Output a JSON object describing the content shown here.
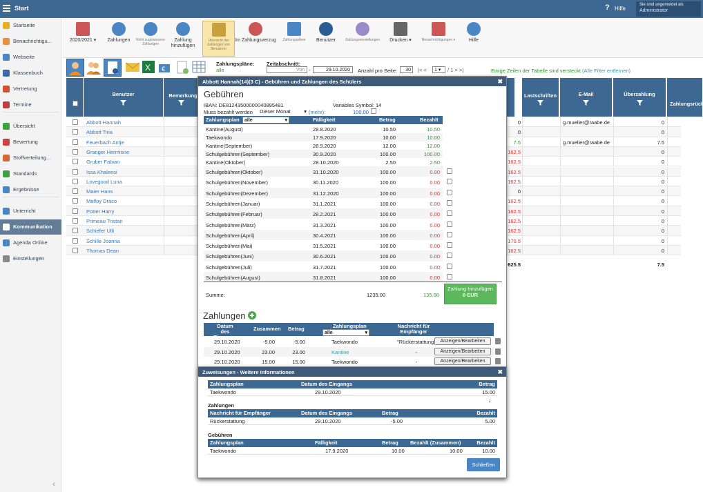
{
  "topbar": {
    "title": "Start",
    "help": "Hilfe",
    "user_line1": "Sie sind angemeldet als",
    "user_line2": "Administrator"
  },
  "sidebar": {
    "items": [
      {
        "label": "Startseite",
        "color": "#e8b020"
      },
      {
        "label": "Benachrichtigu...",
        "color": "#e89040"
      },
      {
        "label": "Webseite",
        "color": "#4a86c4"
      },
      {
        "label": "Klassenbuch",
        "color": "#3a6aa8"
      },
      {
        "label": "Vertretung",
        "color": "#d05030"
      },
      {
        "label": "Termine",
        "color": "#c04040"
      },
      {
        "label": "Übersicht",
        "color": "#40a040"
      },
      {
        "label": "Bewertung",
        "color": "#d04040"
      },
      {
        "label": "Stoffverteilung...",
        "color": "#d06a30"
      },
      {
        "label": "Standards",
        "color": "#40a040"
      },
      {
        "label": "Ergebnisse",
        "color": "#4a86c4"
      },
      {
        "label": "Unterricht",
        "color": "#4a86c4"
      },
      {
        "label": "Kommunikation",
        "color": "#fff"
      },
      {
        "label": "Agenda Online",
        "color": "#4a86c4"
      },
      {
        "label": "Einstellungen",
        "color": "#888"
      }
    ]
  },
  "toolbar": {
    "items": [
      {
        "label": "2020/2021 ▾",
        "icon": "calendar-icon"
      },
      {
        "label": "Zahlungen",
        "icon": "money-bag-icon"
      },
      {
        "label": "Nicht zugewiesene Zahlungen",
        "icon": "money-bag-icon"
      },
      {
        "label": "Zahlung hinzufügen",
        "icon": "money-add-icon"
      },
      {
        "label": "Übersicht der Zahlungen von Benutzern",
        "icon": "overview-icon"
      },
      {
        "label": "Im Zahlungsverzug",
        "icon": "money-overdue-icon"
      },
      {
        "label": "Zahlungspläne",
        "icon": "plan-icon"
      },
      {
        "label": "Benutzer",
        "icon": "user-icon"
      },
      {
        "label": "Zahlungseinstellungen",
        "icon": "gear-icon"
      },
      {
        "label": "Drucken ▾",
        "icon": "printer-icon"
      },
      {
        "label": "Benachrichtigungen ▾",
        "icon": "phone-icon"
      },
      {
        "label": "Hilfe",
        "icon": "help-icon"
      }
    ]
  },
  "filter": {
    "plans_label": "Zahlungspläne:",
    "plans_value": "alle",
    "period_label": "Zeitabschnitt:",
    "from": "Von",
    "dash": "-",
    "to": "29.10.2020",
    "perpage_label": "Anzahl pro Seite:",
    "perpage": "30",
    "page_nav": "|< <",
    "page": "1",
    "page_total": "/ 1  >  >|",
    "hidden_note": "Einige Zeilen der Tabelle sind versteckt",
    "remove_filters": "(Alle Filter entfernen)"
  },
  "grid": {
    "headers": [
      "Benutzer",
      "Bemerkung",
      "Lastschriften",
      "E-Mail",
      "Überzahlung",
      "Zahlungsrück"
    ],
    "rows": [
      {
        "name": "Abbott Hannah",
        "r1": "0",
        "email": "g.mueller@raabe.de",
        "over": "0"
      },
      {
        "name": "Abbott Tina",
        "r1": "0",
        "email": "",
        "over": "0"
      },
      {
        "name": "Feuerbach Antje",
        "r1": "7.5",
        "email": "g.mueller@raabe.de",
        "over": "7.5"
      },
      {
        "name": "Granger Hermione",
        "r1": "162.5",
        "email": "",
        "over": "0"
      },
      {
        "name": "Gruber Fabian",
        "r1": "162.5",
        "email": "",
        "over": "0"
      },
      {
        "name": "Issa Khaleesi",
        "r1": "162.5",
        "email": "",
        "over": "0"
      },
      {
        "name": "Lovegood Luna",
        "r1": "162.5",
        "email": "",
        "over": "0"
      },
      {
        "name": "Maier Hans",
        "r1": "0",
        "email": "",
        "over": "0"
      },
      {
        "name": "Malfoy Draco",
        "r1": "162.5",
        "email": "",
        "over": "0"
      },
      {
        "name": "Potter Harry",
        "r1": "162.5",
        "email": "",
        "over": "0"
      },
      {
        "name": "Primeau Tristan",
        "r1": "162.5",
        "email": "",
        "over": "0"
      },
      {
        "name": "Schiefer Ulli",
        "r1": "162.5",
        "email": "",
        "over": "0"
      },
      {
        "name": "Schille Joanna",
        "r1": "170.5",
        "email": "",
        "over": "0"
      },
      {
        "name": "Thomas Dean",
        "r1": "162.5",
        "email": "",
        "over": "0"
      }
    ],
    "total_r1": "625.5",
    "total_over": "7.5"
  },
  "modal": {
    "title": "Abbott Hannah(14)(3 C) - Gebühren und Zahlungen des Schülers",
    "heading": "Gebühren",
    "iban": "IBAN: DE81243500000040895481",
    "variable": "Variables Symbol: 14",
    "must_pay": "Muss bezahlt werden",
    "must_pay_value": "Dieser Monat",
    "more": "(mehr):",
    "more_value": "100.00",
    "fee_headers": [
      "Zahlungsplan",
      "Fälligkeit",
      "Betrag",
      "Bezahlt"
    ],
    "fee_plan_select": "alle",
    "fees": [
      {
        "plan": "Kantine(August)",
        "due": "28.8.2020",
        "amount": "10.50",
        "paid": "10.50",
        "st": "g",
        "cb": false
      },
      {
        "plan": "Taekwondo",
        "due": "17.9.2020",
        "amount": "10.00",
        "paid": "10.00",
        "st": "g",
        "cb": false
      },
      {
        "plan": "Kantine(September)",
        "due": "28.9.2020",
        "amount": "12.00",
        "paid": "12.00",
        "st": "g",
        "cb": false
      },
      {
        "plan": "Schulgebühren(September)",
        "due": "30.9.2020",
        "amount": "100.00",
        "paid": "100.00",
        "st": "g",
        "cb": false
      },
      {
        "plan": "Kantine(Oktober)",
        "due": "28.10.2020",
        "amount": "2.50",
        "paid": "2.50",
        "st": "g",
        "cb": false
      },
      {
        "plan": "Schulgebühren(Oktober)",
        "due": "31.10.2020",
        "amount": "100.00",
        "paid": "0.00",
        "st": "r",
        "cb": true
      },
      {
        "plan": "Schulgebühren(November)",
        "due": "30.11.2020",
        "amount": "100.00",
        "paid": "0.00",
        "st": "r",
        "cb": true
      },
      {
        "plan": "Schulgebühren(Dezember)",
        "due": "31.12.2020",
        "amount": "100.00",
        "paid": "0.00",
        "st": "r",
        "cb": true
      },
      {
        "plan": "Schulgebühren(Januar)",
        "due": "31.1.2021",
        "amount": "100.00",
        "paid": "0.00",
        "st": "r",
        "cb": true
      },
      {
        "plan": "Schulgebühren(Februar)",
        "due": "28.2.2021",
        "amount": "100.00",
        "paid": "0.00",
        "st": "r",
        "cb": true
      },
      {
        "plan": "Schulgebühren(März)",
        "due": "31.3.2021",
        "amount": "100.00",
        "paid": "0.00",
        "st": "r",
        "cb": true
      },
      {
        "plan": "Schulgebühren(April)",
        "due": "30.4.2021",
        "amount": "100.00",
        "paid": "0.00",
        "st": "r",
        "cb": true
      },
      {
        "plan": "Schulgebühren(Mai)",
        "due": "31.5.2021",
        "amount": "100.00",
        "paid": "0.00",
        "st": "r",
        "cb": true
      },
      {
        "plan": "Schulgebühren(Juni)",
        "due": "30.6.2021",
        "amount": "100.00",
        "paid": "0.00",
        "st": "r",
        "cb": true
      },
      {
        "plan": "Schulgebühren(Juli)",
        "due": "31.7.2021",
        "amount": "100.00",
        "paid": "0.00",
        "st": "r",
        "cb": true
      },
      {
        "plan": "Schulgebühren(August)",
        "due": "31.8.2021",
        "amount": "100.00",
        "paid": "0.00",
        "st": "r",
        "cb": true
      }
    ],
    "sum_label": "Summe:",
    "sum_amount": "1235.00",
    "sum_paid": "135.00",
    "add_payment": "Zahlung hinzufügen",
    "add_payment_amount": "0 EUR",
    "payments_heading": "Zahlungen",
    "pay_headers": [
      "Datum des Eingangs",
      "Zusammen",
      "Betrag",
      "Zahlungsplan",
      "Nachricht für Empfänger"
    ],
    "pay_plan_select": "alle",
    "payments": [
      {
        "date": "29.10.2020",
        "total": "-5.00",
        "amount": "-5.00",
        "plan": "Taekwondo",
        "msg": "\"Rückerstattung\"",
        "link": false
      },
      {
        "date": "29.10.2020",
        "total": "23.00",
        "amount": "23.00",
        "plan": "Kantine",
        "msg": "-",
        "link": true
      },
      {
        "date": "29.10.2020",
        "total": "15.00",
        "amount": "15.00",
        "plan": "Taekwondo",
        "msg": "-",
        "link": false
      }
    ],
    "show_edit": "Anzeigen/Bearbeiten"
  },
  "modal2": {
    "title": "Zuweisungen - Weitere Informationen",
    "t1_headers": [
      "Zahlungsplan",
      "Datum des Eingangs",
      "Betrag"
    ],
    "t1_row": [
      "Taekwondo",
      "29.10.2020",
      "15.00"
    ],
    "arrow": "↓",
    "payments_label": "Zahlungen",
    "t2_headers": [
      "Nachricht für Empfänger",
      "Datum des Eingangs",
      "Betrag",
      "Bezahlt"
    ],
    "t2_row": [
      "Rückerstattung",
      "29.10.2020",
      "-5.00",
      "5.00"
    ],
    "fees_label": "Gebühren",
    "t3_headers": [
      "Zahlungsplan",
      "Fälligkeit",
      "Betrag",
      "Bezahlt (Zusammen)",
      "Bezahlt"
    ],
    "t3_row": [
      "Taekwondo",
      "17.9.2020",
      "10.00",
      "10.00",
      "10.00"
    ],
    "close": "Schließen"
  }
}
